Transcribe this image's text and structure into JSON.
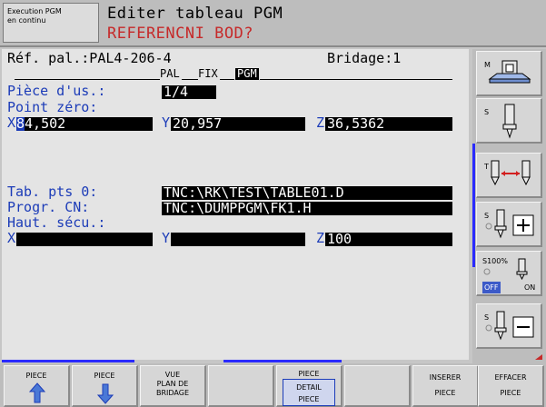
{
  "header": {
    "mode_line1": "Execution PGM",
    "mode_line2": "en continu",
    "title": "Editer tableau PGM",
    "subtitle": "REFERENCNI BOD?"
  },
  "form": {
    "ref_label": "Réf. pal.:PAL4-206-4",
    "bridage_label": "Bridage:1",
    "tag_pal": "PAL",
    "tag_fix": "FIX",
    "tag_pgm": "PGM",
    "piece_label": "Pièce d'us.:",
    "piece_value": "1/4",
    "point_zero_label": "Point zéro:",
    "x_axis": "X",
    "x_cursor": "8",
    "x_value": "4,502",
    "y_axis": "Y",
    "y_value": "20,957",
    "z_axis": "Z",
    "z_value": "36,5362",
    "tab_label": "Tab. pts 0:",
    "tab_value": "TNC:\\RK\\TEST\\TABLE01.D",
    "progr_label": "Progr. CN:",
    "progr_value": "TNC:\\DUMPPGM\\FK1.H",
    "haut_label": "Haut. sécu.:",
    "h_x_axis": "X",
    "h_y_axis": "Y",
    "h_z_axis": "Z",
    "h_z_value": "100"
  },
  "right_softkeys": {
    "m_label": "M",
    "s_label": "S",
    "t_label": "T",
    "s_plus_label": "S",
    "s100_label": "S100%",
    "off_label": "OFF",
    "on_label": "ON",
    "s_minus_label": "S"
  },
  "bottom_softkeys": {
    "piece_up": "PIECE",
    "piece_down": "PIECE",
    "vue_l1": "VUE",
    "vue_l2": "PLAN DE",
    "vue_l3": "BRIDAGE",
    "detail_l1": "PIECE",
    "detail_l2": "DETAIL",
    "detail_l3": "PIECE",
    "inserer_l1": "INSERER",
    "inserer_l2": "PIECE",
    "effacer_l1": "EFFACER",
    "effacer_l2": "PIECE"
  },
  "colors": {
    "highlight_blue": "#1c3cb8",
    "subtitle_red": "#c62a2a",
    "field_black": "#000000"
  }
}
